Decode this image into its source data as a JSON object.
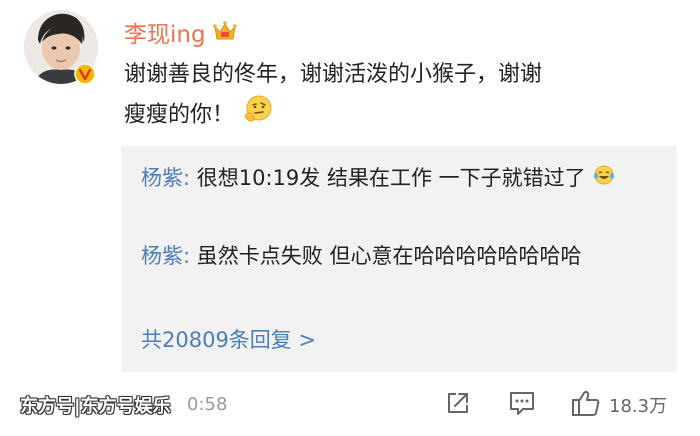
{
  "post": {
    "username": "李现ing",
    "text_line_1": "谢谢善良的佟年，谢谢活泼的小猴子，谢谢",
    "text_line_2": "瘦瘦的你！",
    "emoji": "thinking-face-emoji",
    "crown_icon": "crown-icon",
    "verified_icon": "verified-badge-icon"
  },
  "replies": {
    "items": [
      {
        "author": "杨紫",
        "separator": ": ",
        "text": "很想10:19发 结果在工作 一下子就错过了",
        "emoji": "laughing-tears-emoji"
      },
      {
        "author": "杨紫",
        "separator": ": ",
        "text": "虽然卡点失败 但心意在哈哈哈哈哈哈哈哈"
      }
    ],
    "more_label": "共20809条回复 >"
  },
  "footer": {
    "timestamp": "0:58",
    "watermark": "东方号|东方号娱乐",
    "like_count": "18.3万"
  },
  "colors": {
    "username": "#eb7350",
    "link": "#4a7dbd",
    "reply_bg": "#f2f2f2",
    "text": "#222222",
    "muted": "#999999"
  }
}
